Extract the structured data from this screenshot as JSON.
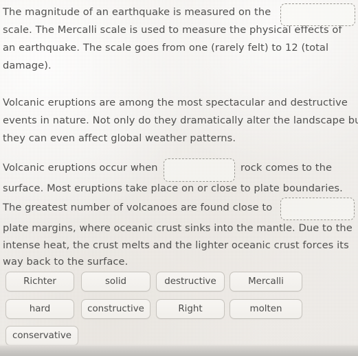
{
  "worksheet": {
    "paragraph1": {
      "line1_before_blank": "The magnitude of an earthquake is measured on the",
      "line2": "scale. The Mercalli scale is used to measure the physical effects of",
      "line3": "an earthquake. The scale goes from one (rarely felt) to 12 (total",
      "line4": "damage)."
    },
    "paragraph2": {
      "line1": "Volcanic eruptions are among the most spectacular and  destructive",
      "line2": "events in nature. Not only do they dramatically alter the landscape bu",
      "line3": " they can even affect global weather patterns."
    },
    "paragraph3": {
      "line1_before_blank": "Volcanic eruptions occur when",
      "line1_after_blank": "rock comes to the",
      "line2": "surface. Most eruptions take place on or close to plate  boundaries.",
      "line3_before_blank": "The greatest number of volcanoes are found close to",
      "line4": "plate margins, where oceanic crust sinks into the mantle. Due to the",
      "line5": "intense heat, the crust melts and the lighter oceanic crust forces its",
      "line6": "way back to the surface."
    },
    "blanks": [
      {
        "id": "blank-1",
        "value": ""
      },
      {
        "id": "blank-2",
        "value": ""
      },
      {
        "id": "blank-3",
        "value": ""
      }
    ],
    "options": [
      {
        "label": "Richter"
      },
      {
        "label": "solid"
      },
      {
        "label": "destructive"
      },
      {
        "label": "Mercalli"
      },
      {
        "label": "hard"
      },
      {
        "label": "constructive"
      },
      {
        "label": "Right"
      },
      {
        "label": "molten"
      },
      {
        "label": "conservative"
      }
    ]
  },
  "colors": {
    "page_background": "#f3f1ee",
    "text": "#50504f",
    "blank_border": "#9a9892",
    "option_border": "#c6c3bd",
    "option_background": "#f4f2ef",
    "bottom_band": "#c9c7c4"
  }
}
